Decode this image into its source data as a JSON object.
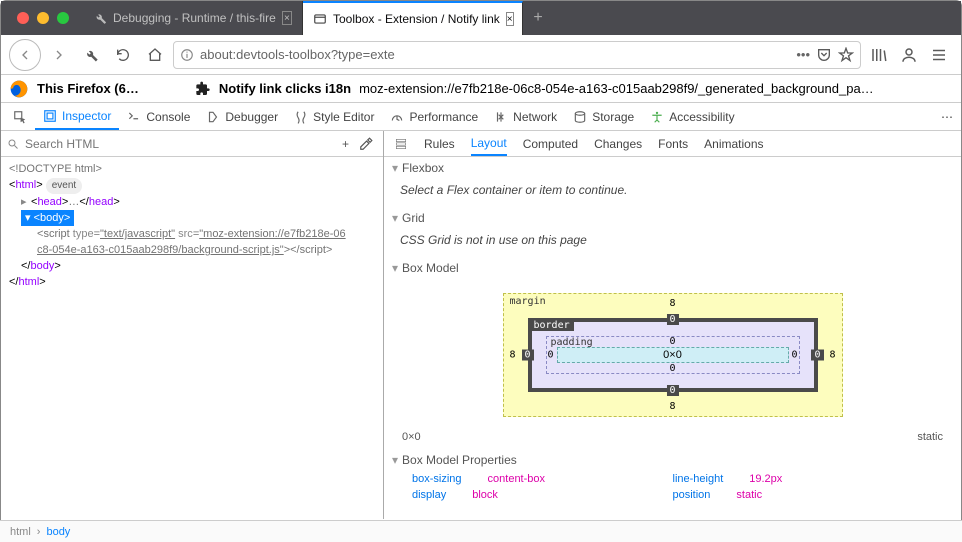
{
  "titlebar": {
    "tabs": [
      {
        "label": "Debugging - Runtime / this-fire",
        "active": false
      },
      {
        "label": "Toolbox - Extension / Notify link",
        "active": true
      }
    ]
  },
  "url": "about:devtools-toolbox?type=exte",
  "breadcrumb": {
    "firefox_label": "This Firefox (6…",
    "ext_name": "Notify link clicks i18n",
    "ext_path": "moz-extension://e7fb218e-06c8-054e-a163-c015aab298f9/_generated_background_pa…"
  },
  "devtools_tabs": [
    "Inspector",
    "Console",
    "Debugger",
    "Style Editor",
    "Performance",
    "Network",
    "Storage",
    "Accessibility"
  ],
  "devtools_active": "Inspector",
  "search_placeholder": "Search HTML",
  "markup": {
    "doctype": "<!DOCTYPE html>",
    "html_open": "html",
    "event_pill": "event",
    "head_open": "head",
    "head_dots": "…",
    "head_close": "head",
    "body": "body",
    "script_tag": "script",
    "script_type_attr": "type",
    "script_type_val": "\"text/javascript\"",
    "script_src_attr": "src",
    "script_src_val": "\"moz-extension://e7fb218e-06c8-054e-a163-c015aab298f9/background-script.js\"",
    "body_close": "body",
    "html_close": "html"
  },
  "subtabs": [
    "Rules",
    "Layout",
    "Computed",
    "Changes",
    "Fonts",
    "Animations"
  ],
  "subtab_active": "Layout",
  "flexbox": {
    "title": "Flexbox",
    "hint": "Select a Flex container or item to continue."
  },
  "grid": {
    "title": "Grid",
    "hint": "CSS Grid is not in use on this page"
  },
  "boxmodel": {
    "title": "Box Model",
    "margin_label": "margin",
    "border_label": "border",
    "padding_label": "padding",
    "content": "0×0",
    "m_top": "8",
    "m_right": "8",
    "m_bottom": "8",
    "m_left": "8",
    "b_top": "0",
    "b_right": "0",
    "b_bottom": "0",
    "b_left": "0",
    "p_top": "0",
    "p_right": "0",
    "p_bottom": "0",
    "p_left": "0"
  },
  "dims": {
    "size": "0×0",
    "pos": "static"
  },
  "props_title": "Box Model Properties",
  "props": [
    {
      "name": "box-sizing",
      "value": "content-box"
    },
    {
      "name": "line-height",
      "value": "19.2px"
    },
    {
      "name": "display",
      "value": "block"
    },
    {
      "name": "position",
      "value": "static"
    }
  ],
  "crumbs": {
    "root": "html",
    "sel": "body"
  }
}
